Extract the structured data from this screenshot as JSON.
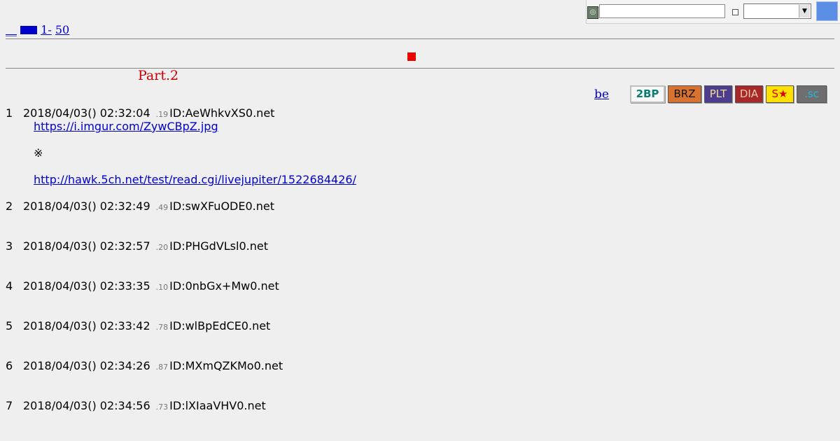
{
  "nav": {
    "link1": "__",
    "link2": "1-",
    "link3": "50"
  },
  "part_title": "Part.2",
  "be_label": "be",
  "badges": [
    "2BP",
    "BRZ",
    "PLT",
    "DIA",
    "S★",
    ".sc"
  ],
  "posts": [
    {
      "num": "1",
      "date": "2018/04/03() 02:32:04",
      "tiny": ".19",
      "id": "ID:AeWhkvXS0.net",
      "link1": "https://i.imgur.com/ZywCBpZ.jpg",
      "mark": "※",
      "link2": "http://hawk.5ch.net/test/read.cgi/livejupiter/1522684426/"
    },
    {
      "num": "2",
      "date": "2018/04/03() 02:32:49",
      "tiny": ".49",
      "id": "ID:swXFuODE0.net"
    },
    {
      "num": "3",
      "date": "2018/04/03() 02:32:57",
      "tiny": ".20",
      "id": "ID:PHGdVLsl0.net"
    },
    {
      "num": "4",
      "date": "2018/04/03() 02:33:35",
      "tiny": ".10",
      "id": "ID:0nbGx+Mw0.net"
    },
    {
      "num": "5",
      "date": "2018/04/03() 02:33:42",
      "tiny": ".78",
      "id": "ID:wlBpEdCE0.net"
    },
    {
      "num": "6",
      "date": "2018/04/03() 02:34:26",
      "tiny": ".87",
      "id": "ID:MXmQZKMo0.net"
    },
    {
      "num": "7",
      "date": "2018/04/03() 02:34:56",
      "tiny": ".73",
      "id": "ID:lXIaaVHV0.net"
    }
  ]
}
